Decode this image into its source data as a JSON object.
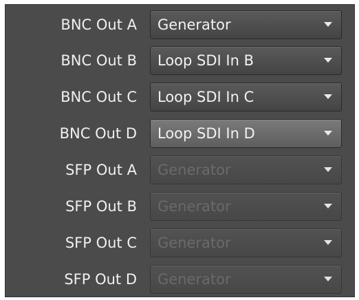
{
  "outputs": [
    {
      "label": "BNC Out A",
      "value": "Generator",
      "enabled": true,
      "highlighted": false
    },
    {
      "label": "BNC Out B",
      "value": "Loop SDI In B",
      "enabled": true,
      "highlighted": false
    },
    {
      "label": "BNC Out C",
      "value": "Loop SDI In C",
      "enabled": true,
      "highlighted": false
    },
    {
      "label": "BNC Out D",
      "value": "Loop SDI In D",
      "enabled": true,
      "highlighted": true
    },
    {
      "label": "SFP Out A",
      "value": "Generator",
      "enabled": false,
      "highlighted": false
    },
    {
      "label": "SFP Out B",
      "value": "Generator",
      "enabled": false,
      "highlighted": false
    },
    {
      "label": "SFP Out C",
      "value": "Generator",
      "enabled": false,
      "highlighted": false
    },
    {
      "label": "SFP Out D",
      "value": "Generator",
      "enabled": false,
      "highlighted": false
    }
  ],
  "colors": {
    "panel_background": "#4b4b4b",
    "label_text": "#f0f0f0",
    "enabled_value_text": "#f2f2f2",
    "disabled_value_text": "#6a6a6a",
    "dropdown_arrow": "#eaeaea"
  },
  "icons": {
    "dropdown_arrow": "chevron-down-icon"
  }
}
